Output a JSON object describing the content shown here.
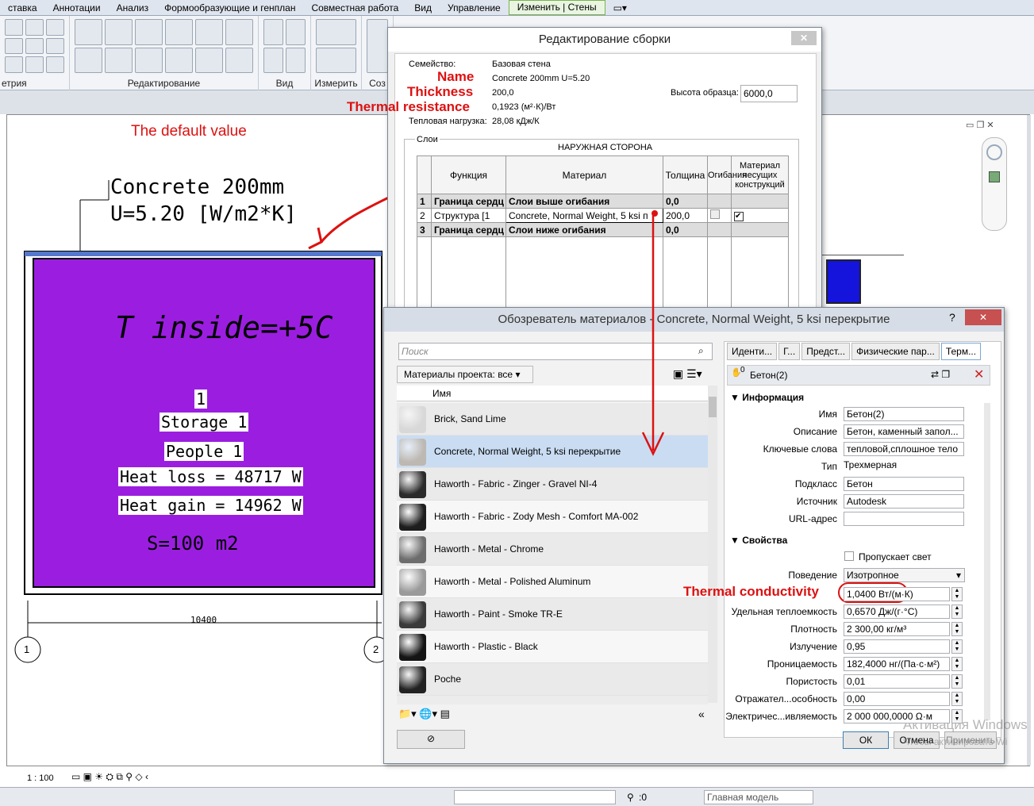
{
  "ribbon": {
    "tabs": [
      "ставка",
      "Аннотации",
      "Анализ",
      "Формообразующие и генплан",
      "Совместная работа",
      "Вид",
      "Управление",
      "Изменить | Стены"
    ],
    "groups": [
      "етрия",
      "Редактирование",
      "Вид",
      "Измерить",
      "Соз"
    ]
  },
  "annotations": {
    "name": "Name",
    "thickness": "Thickness",
    "thermal_resistance": "Thermal resistance",
    "default_value": "The default value",
    "thermal_conductivity": "Thermal conductivity"
  },
  "drawing": {
    "wall_tag_line1": "Concrete 200mm",
    "wall_tag_line2": "U=5.20 [W/m2*K]",
    "room_title": "T inside=+5C",
    "room_number": "1",
    "room_name": "Storage 1",
    "people": "People 1",
    "heat_loss": "Heat loss = 48717 W",
    "heat_gain": "Heat gain = 14962 W",
    "area": "S=100 m2",
    "dimension": "10400",
    "grid1": "1",
    "grid2": "2",
    "scale": "1 : 100"
  },
  "assembly": {
    "title": "Редактирование сборки",
    "family_label": "Семейство:",
    "family_value": "Базовая стена",
    "type_value": "Concrete 200mm U=5.20",
    "thickness_value": "200,0",
    "resistance_value": "0,1923 (м²·К)/Вт",
    "heat_label": "Тепловая нагрузка:",
    "heat_value": "28,08 кДж/К",
    "sample_label": "Высота образца:",
    "sample_value": "6000,0",
    "layers_label": "Слои",
    "outer_side": "НАРУЖНАЯ СТОРОНА",
    "columns": [
      "Функция",
      "Материал",
      "Толщина",
      "Огибания",
      "Материал несущих конструкций"
    ],
    "rows": [
      {
        "n": "1",
        "func": "Граница сердц",
        "mat": "Слои выше огибания",
        "thk": "0,0"
      },
      {
        "n": "2",
        "func": "Структура [1",
        "mat": "Concrete, Normal Weight, 5 ksi п",
        "thk": "200,0"
      },
      {
        "n": "3",
        "func": "Граница сердц",
        "mat": "Слои ниже огибания",
        "thk": "0,0"
      }
    ]
  },
  "browser": {
    "title": "Обозреватель материалов - Concrete, Normal Weight, 5 ksi перекрытие",
    "help": "?",
    "search_placeholder": "Поиск",
    "filter": "Материалы проекта: все",
    "col_name": "Имя",
    "materials": [
      {
        "name": "Brick, Sand Lime",
        "color": "#d8d8d8"
      },
      {
        "name": "Concrete, Normal Weight, 5 ksi перекрытие",
        "color": "#bdb8b2"
      },
      {
        "name": "Haworth - Fabric - Zinger - Gravel NI-4",
        "color": "#2b2b2b"
      },
      {
        "name": "Haworth - Fabric - Zody Mesh - Comfort MA-002",
        "color": "#1e1e1e"
      },
      {
        "name": "Haworth - Metal - Chrome",
        "color": "#6d6d6d"
      },
      {
        "name": "Haworth - Metal - Polished Aluminum",
        "color": "#9a9a9a"
      },
      {
        "name": "Haworth - Paint - Smoke TR-E",
        "color": "#3a3a3a"
      },
      {
        "name": "Haworth - Plastic - Black",
        "color": "#151515"
      },
      {
        "name": "Poche",
        "color": "#222"
      }
    ],
    "tabs": [
      "Иденти...",
      "Г...",
      "Предст...",
      "Физические пар...",
      "Терм..."
    ],
    "asset_name": "Бетон(2)",
    "asset_count": "0",
    "info_header": "Информация",
    "info": [
      {
        "label": "Имя",
        "value": "Бетон(2)"
      },
      {
        "label": "Описание",
        "value": "Бетон, каменный запол..."
      },
      {
        "label": "Ключевые слова",
        "value": "тепловой,сплошное тело"
      },
      {
        "label": "Тип",
        "value": "Трехмерная"
      },
      {
        "label": "Подкласс",
        "value": "Бетон"
      },
      {
        "label": "Источник",
        "value": "Autodesk"
      },
      {
        "label": "URL-адрес",
        "value": ""
      }
    ],
    "props_header": "Свойства",
    "transmits_light": "Пропускает свет",
    "behavior_label": "Поведение",
    "behavior_value": "Изотропное",
    "props": [
      {
        "label": "",
        "value": "1,0400 Вт/(м·К)"
      },
      {
        "label": "Удельная теплоемкость",
        "value": "0,6570 Дж/(г·°С)"
      },
      {
        "label": "Плотность",
        "value": "2 300,00 кг/м³"
      },
      {
        "label": "Излучение",
        "value": "0,95"
      },
      {
        "label": "Проницаемость",
        "value": "182,4000 нг/(Па·с·м²)"
      },
      {
        "label": "Пористость",
        "value": "0,01"
      },
      {
        "label": "Отражател...особность",
        "value": "0,00"
      },
      {
        "label": "Электричес...ивляемость",
        "value": "2 000 000,0000 Ω·м"
      }
    ],
    "ok": "ОК",
    "cancel": "Отмена",
    "apply": "Применить"
  },
  "watermark": {
    "line1": "Активация Windows",
    "line2": "Чтобы активировать Wi"
  },
  "status": {
    "coord": ":0",
    "model": "Главная модель"
  }
}
